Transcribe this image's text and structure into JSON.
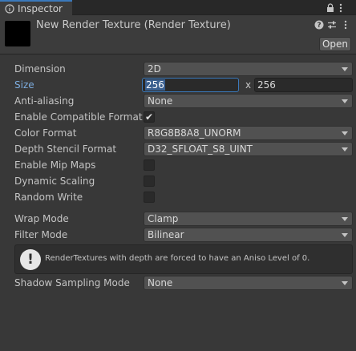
{
  "tab": {
    "label": "Inspector"
  },
  "header": {
    "title": "New Render Texture (Render Texture)",
    "open_label": "Open"
  },
  "rows": {
    "dimension": {
      "label": "Dimension",
      "value": "2D"
    },
    "size": {
      "label": "Size",
      "width": "256",
      "height": "256",
      "separator": "x"
    },
    "anti_aliasing": {
      "label": "Anti-aliasing",
      "value": "None"
    },
    "compatible_format": {
      "label": "Enable Compatible Format",
      "checked": true,
      "mark": "✔"
    },
    "color_format": {
      "label": "Color Format",
      "value": "R8G8B8A8_UNORM"
    },
    "depth_stencil": {
      "label": "Depth Stencil Format",
      "value": "D32_SFLOAT_S8_UINT"
    },
    "mip_maps": {
      "label": "Enable Mip Maps",
      "checked": false
    },
    "dynamic_scaling": {
      "label": "Dynamic Scaling",
      "checked": false
    },
    "random_write": {
      "label": "Random Write",
      "checked": false
    },
    "wrap_mode": {
      "label": "Wrap Mode",
      "value": "Clamp"
    },
    "filter_mode": {
      "label": "Filter Mode",
      "value": "Bilinear"
    },
    "shadow_sampling": {
      "label": "Shadow Sampling Mode",
      "value": "None"
    }
  },
  "help": {
    "icon": "warning-icon",
    "glyph": "!",
    "text": "RenderTextures with depth are forced to have an Aniso Level of 0."
  },
  "colors": {
    "accent": "#3a79bb",
    "label_highlight": "#7cacde",
    "background": "#383838"
  }
}
